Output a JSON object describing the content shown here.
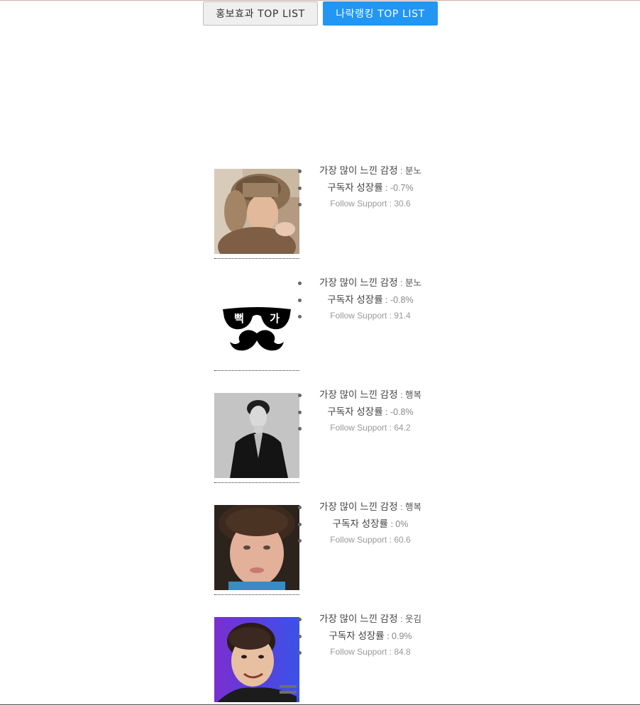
{
  "tabs": {
    "promo_label": "홍보효과 TOP LIST",
    "ranking_label": "나락랭킹 TOP LIST"
  },
  "labels": {
    "emotion": "가장 많이 느낀 감정",
    "growth": "구독자 성장률",
    "follow": "Follow Support",
    "separator": ":"
  },
  "items": [
    {
      "avatar": "person-in-fur-hat",
      "emotion": "분노",
      "growth": "-0.7%",
      "follow": "30.6"
    },
    {
      "avatar": "sunglasses-mustache-logo",
      "logo_text": [
        "뻑",
        "가"
      ],
      "emotion": "분노",
      "growth": "-0.8%",
      "follow": "91.4"
    },
    {
      "avatar": "man-in-black-suit",
      "emotion": "행복",
      "growth": "-0.8%",
      "follow": "64.2"
    },
    {
      "avatar": "curly-hair-face",
      "emotion": "행복",
      "growth": "0%",
      "follow": "60.6"
    },
    {
      "avatar": "cartoon-avatar",
      "emotion": "웃김",
      "growth": "0.9%",
      "follow": "84.8"
    }
  ],
  "colors": {
    "active_tab": "#2196f3",
    "inactive_tab": "#efefef"
  }
}
